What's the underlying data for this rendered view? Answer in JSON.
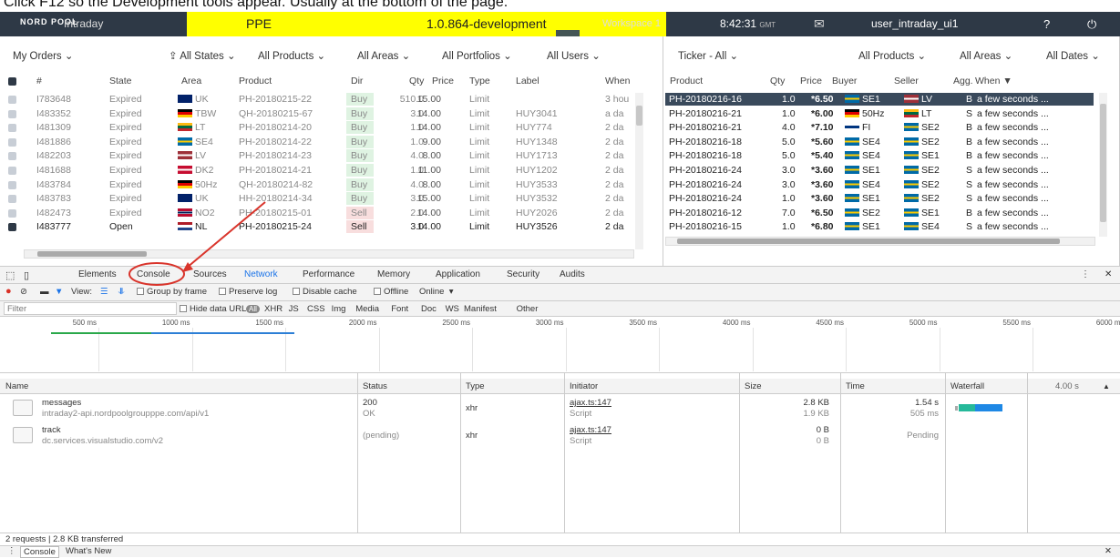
{
  "instruction": "Click F12 so the Development tools appear. Usually at the bottom of the page.",
  "topbar": {
    "logo": "NORD POOL",
    "app_name": "Intraday",
    "env_name": "PPE",
    "version": "1.0.864-development",
    "workspace": "Workspace 1",
    "time": "8:42:31",
    "timezone": "GMT",
    "user": "user_intraday_ui1",
    "env_color": "#ffff00"
  },
  "orders": {
    "header": {
      "title": "My Orders",
      "states": "All States",
      "products": "All Products",
      "areas": "All Areas",
      "portfolios": "All Portfolios",
      "users": "All Users"
    },
    "columns": [
      "#",
      "State",
      "Area",
      "Product",
      "Dir",
      "Qty",
      "Price",
      "Type",
      "Label",
      "When"
    ],
    "rows": [
      {
        "id": "I783648",
        "state": "Expired",
        "area": "UK",
        "flag": "uk",
        "product": "PH-20180215-22",
        "dir": "Buy",
        "qty": "510.0",
        "price": "15.00",
        "type": "Limit",
        "label": "",
        "when": "3 hou"
      },
      {
        "id": "I483352",
        "state": "Expired",
        "area": "TBW",
        "flag": "de",
        "product": "QH-20180215-67",
        "dir": "Buy",
        "qty": "3.0",
        "price": "14.00",
        "type": "Limit",
        "label": "HUY3041",
        "when": "a da"
      },
      {
        "id": "I481309",
        "state": "Expired",
        "area": "LT",
        "flag": "lt",
        "product": "PH-20180214-20",
        "dir": "Buy",
        "qty": "1.0",
        "price": "14.00",
        "type": "Limit",
        "label": "HUY774",
        "when": "2 da"
      },
      {
        "id": "I481886",
        "state": "Expired",
        "area": "SE4",
        "flag": "se",
        "product": "PH-20180214-22",
        "dir": "Buy",
        "qty": "1.0",
        "price": "9.00",
        "type": "Limit",
        "label": "HUY1348",
        "when": "2 da"
      },
      {
        "id": "I482203",
        "state": "Expired",
        "area": "LV",
        "flag": "lv",
        "product": "PH-20180214-23",
        "dir": "Buy",
        "qty": "4.0",
        "price": "8.00",
        "type": "Limit",
        "label": "HUY1713",
        "when": "2 da"
      },
      {
        "id": "I481688",
        "state": "Expired",
        "area": "DK2",
        "flag": "dk",
        "product": "PH-20180214-21",
        "dir": "Buy",
        "qty": "1.0",
        "price": "11.00",
        "type": "Limit",
        "label": "HUY1202",
        "when": "2 da"
      },
      {
        "id": "I483784",
        "state": "Expired",
        "area": "50Hz",
        "flag": "de",
        "product": "QH-20180214-82",
        "dir": "Buy",
        "qty": "4.0",
        "price": "8.00",
        "type": "Limit",
        "label": "HUY3533",
        "when": "2 da"
      },
      {
        "id": "I483783",
        "state": "Expired",
        "area": "UK",
        "flag": "uk",
        "product": "HH-20180214-34",
        "dir": "Buy",
        "qty": "3.0",
        "price": "15.00",
        "type": "Limit",
        "label": "HUY3532",
        "when": "2 da"
      },
      {
        "id": "I482473",
        "state": "Expired",
        "area": "NO2",
        "flag": "no",
        "product": "PH-20180215-01",
        "dir": "Sell",
        "qty": "2.0",
        "price": "14.00",
        "type": "Limit",
        "label": "HUY2026",
        "when": "2 da"
      },
      {
        "id": "I483777",
        "state": "Open",
        "area": "NL",
        "flag": "nl",
        "product": "PH-20180215-24",
        "dir": "Sell",
        "qty": "3.0",
        "price": "14.00",
        "type": "Limit",
        "label": "HUY3526",
        "when": "2 da"
      }
    ]
  },
  "ticker": {
    "header": {
      "title": "Ticker - All",
      "products": "All Products",
      "areas": "All Areas",
      "dates": "All Dates"
    },
    "columns": [
      "Product",
      "Qty",
      "Price",
      "Buyer",
      "Seller",
      "Agg.",
      "When"
    ],
    "rows": [
      {
        "product": "PH-20180216-16",
        "qty": "1.0",
        "price": "*6.50",
        "buyer": "SE1",
        "bflag": "se",
        "seller": "LV",
        "sflag": "lv",
        "agg": "B",
        "when": "a few seconds ..."
      },
      {
        "product": "PH-20180216-21",
        "qty": "1.0",
        "price": "*6.00",
        "buyer": "50Hz",
        "bflag": "de",
        "seller": "LT",
        "sflag": "lt",
        "agg": "S",
        "when": "a few seconds ..."
      },
      {
        "product": "PH-20180216-21",
        "qty": "4.0",
        "price": "*7.10",
        "buyer": "FI",
        "bflag": "fi",
        "seller": "SE2",
        "sflag": "se",
        "agg": "B",
        "when": "a few seconds ..."
      },
      {
        "product": "PH-20180216-18",
        "qty": "5.0",
        "price": "*5.60",
        "buyer": "SE4",
        "bflag": "se",
        "seller": "SE2",
        "sflag": "se",
        "agg": "B",
        "when": "a few seconds ..."
      },
      {
        "product": "PH-20180216-18",
        "qty": "5.0",
        "price": "*5.40",
        "buyer": "SE4",
        "bflag": "se",
        "seller": "SE1",
        "sflag": "se",
        "agg": "B",
        "when": "a few seconds ..."
      },
      {
        "product": "PH-20180216-24",
        "qty": "3.0",
        "price": "*3.60",
        "buyer": "SE1",
        "bflag": "se",
        "seller": "SE2",
        "sflag": "se",
        "agg": "S",
        "when": "a few seconds ..."
      },
      {
        "product": "PH-20180216-24",
        "qty": "3.0",
        "price": "*3.60",
        "buyer": "SE4",
        "bflag": "se",
        "seller": "SE2",
        "sflag": "se",
        "agg": "S",
        "when": "a few seconds ..."
      },
      {
        "product": "PH-20180216-24",
        "qty": "1.0",
        "price": "*3.60",
        "buyer": "SE1",
        "bflag": "se",
        "seller": "SE2",
        "sflag": "se",
        "agg": "S",
        "when": "a few seconds ..."
      },
      {
        "product": "PH-20180216-12",
        "qty": "7.0",
        "price": "*6.50",
        "buyer": "SE2",
        "bflag": "se",
        "seller": "SE1",
        "sflag": "se",
        "agg": "B",
        "when": "a few seconds ..."
      },
      {
        "product": "PH-20180216-15",
        "qty": "1.0",
        "price": "*6.80",
        "buyer": "SE1",
        "bflag": "se",
        "seller": "SE4",
        "sflag": "se",
        "agg": "S",
        "when": "a few seconds ..."
      }
    ]
  },
  "devtools": {
    "tabs": [
      "Elements",
      "Console",
      "Sources",
      "Network",
      "Performance",
      "Memory",
      "Application",
      "Security",
      "Audits"
    ],
    "active_tab": "Network",
    "toolbar": {
      "view": "View:",
      "group": "Group by frame",
      "preserve": "Preserve log",
      "disable_cache": "Disable cache",
      "offline": "Offline",
      "online": "Online"
    },
    "filter": {
      "placeholder": "Filter",
      "hide_data": "Hide data URLs",
      "all": "All",
      "types": [
        "XHR",
        "JS",
        "CSS",
        "Img",
        "Media",
        "Font",
        "Doc",
        "WS",
        "Manifest",
        "Other"
      ]
    },
    "timeline_ticks": [
      "500 ms",
      "1000 ms",
      "1500 ms",
      "2000 ms",
      "2500 ms",
      "3000 ms",
      "3500 ms",
      "4000 ms",
      "4500 ms",
      "5000 ms",
      "5500 ms",
      "6000 ms"
    ],
    "net_columns": [
      "Name",
      "Status",
      "Type",
      "Initiator",
      "Size",
      "Time",
      "Waterfall"
    ],
    "waterfall_scale": "4.00 s",
    "requests": [
      {
        "name": "messages",
        "url": "intraday2-api.nordpoolgroupppe.com/api/v1",
        "status": "200",
        "status_text": "OK",
        "type": "xhr",
        "initiator": "ajax.ts:147",
        "initiator_type": "Script",
        "size": "2.8 KB",
        "size2": "1.9 KB",
        "time": "1.54 s",
        "time2": "505 ms"
      },
      {
        "name": "track",
        "url": "dc.services.visualstudio.com/v2",
        "status": "(pending)",
        "status_text": "",
        "type": "xhr",
        "initiator": "ajax.ts:147",
        "initiator_type": "Script",
        "size": "0 B",
        "size2": "0 B",
        "time": "Pending",
        "time2": ""
      }
    ],
    "summary": "2 requests | 2.8 KB transferred",
    "drawer_tabs": [
      "Console",
      "What's New"
    ]
  },
  "annotation_color": "#d9342b"
}
